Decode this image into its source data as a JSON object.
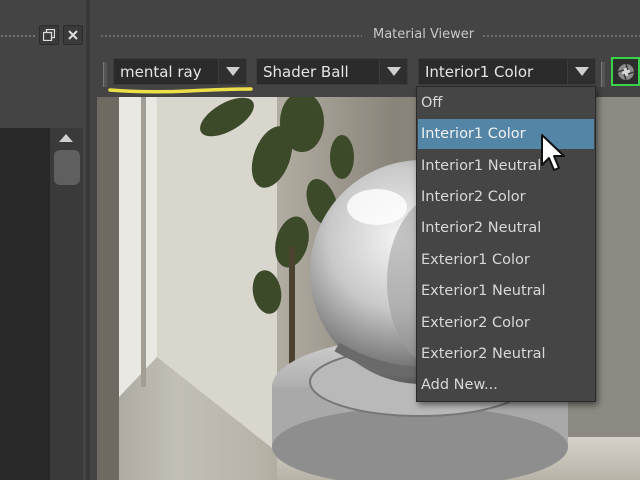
{
  "panel": {
    "title": "Material Viewer"
  },
  "toolbar": {
    "renderer": "mental ray",
    "geometry": "Shader Ball",
    "environment": "Interior1 Color"
  },
  "menu": {
    "items": [
      {
        "label": "Off"
      },
      {
        "label": "Interior1 Color",
        "selected": true
      },
      {
        "label": "Interior1 Neutral"
      },
      {
        "label": "Interior2 Color"
      },
      {
        "label": "Interior2 Neutral"
      },
      {
        "label": "Exterior1 Color"
      },
      {
        "label": "Exterior1 Neutral"
      },
      {
        "label": "Exterior2 Color"
      },
      {
        "label": "Exterior2 Neutral"
      },
      {
        "label": "Add New..."
      }
    ]
  },
  "colors": {
    "selection": "#5285a6",
    "highlighter": "#f5e84a",
    "render_frame": "#39d24a"
  },
  "icons": {
    "float": "float-window-icon",
    "close": "close-icon",
    "render": "render-view-icon",
    "cursor": "mouse-pointer-icon"
  }
}
